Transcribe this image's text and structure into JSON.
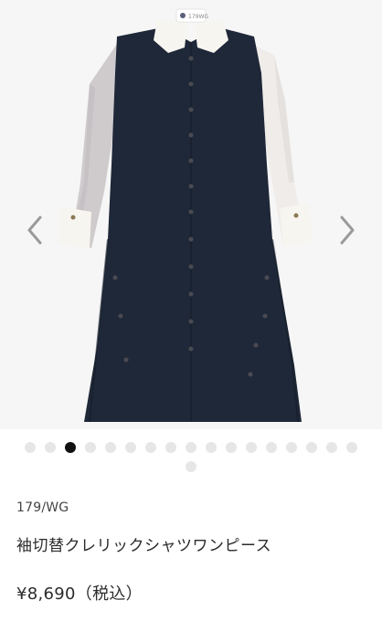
{
  "product": {
    "brand": "179/WG",
    "name": "袖切替クレリックシャツワンピース",
    "price": "¥8,690（税込）",
    "logo_text": "179WG"
  },
  "gallery": {
    "image_count": 18,
    "active_index": 2,
    "prev_icon": "chevron-left-icon",
    "next_icon": "chevron-right-icon"
  },
  "colors": {
    "dress_body": "#1f2838",
    "sleeve": "#cfcbcd",
    "collar": "#f7f5f0",
    "background": "#f6f6f6"
  }
}
